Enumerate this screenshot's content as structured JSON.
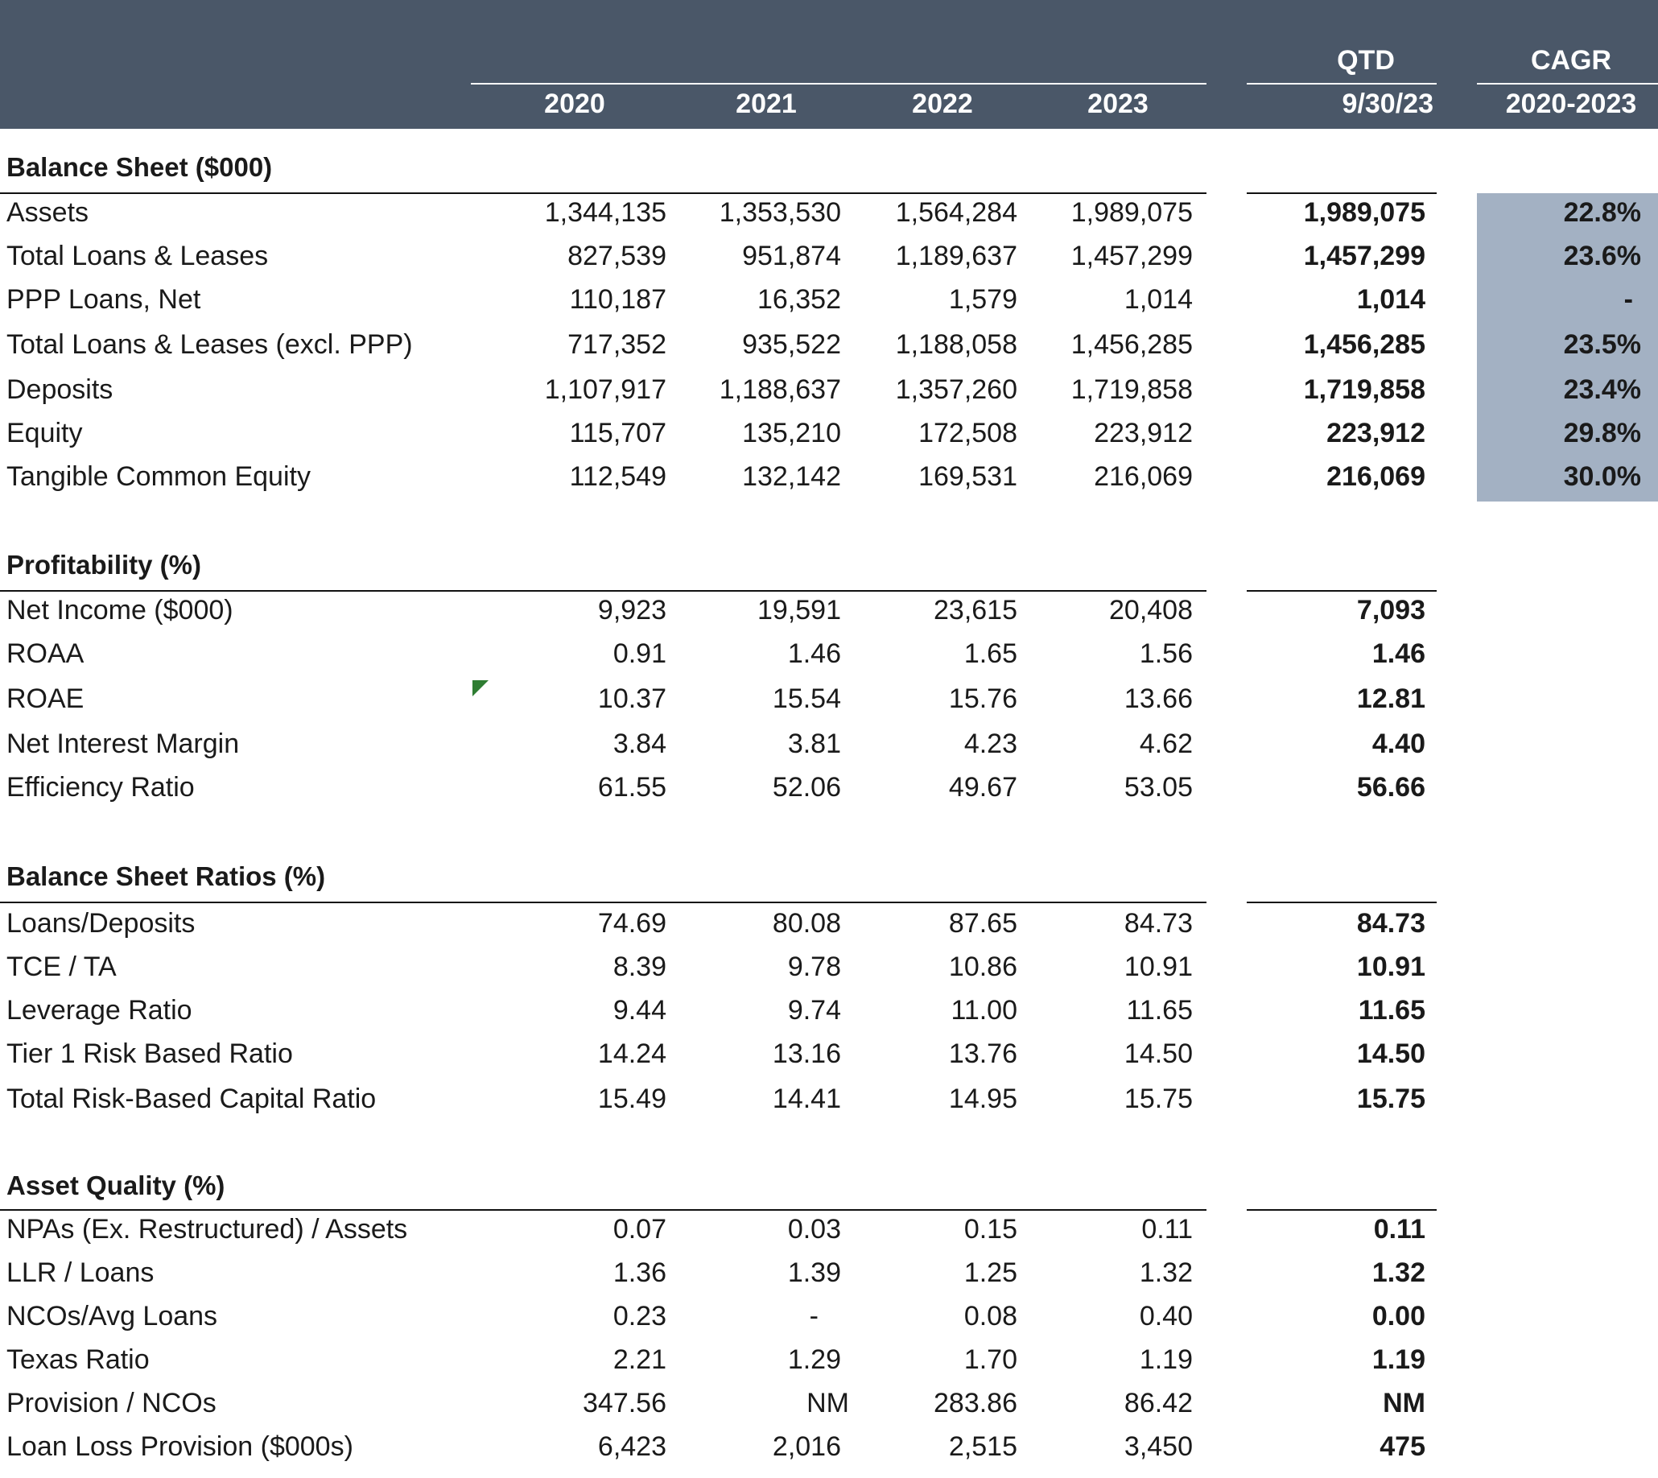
{
  "header": {
    "years": [
      "2020",
      "2021",
      "2022",
      "2023"
    ],
    "qtd_top": "QTD",
    "qtd_bottom": "9/30/23",
    "cagr_top": "CAGR",
    "cagr_bottom": "2020-2023"
  },
  "sections": [
    {
      "title": "Balance Sheet ($000)",
      "rows": [
        {
          "label": "Assets",
          "values": [
            "1,344,135",
            "1,353,530",
            "1,564,284",
            "1,989,075"
          ],
          "qtd": "1,989,075",
          "cagr": "22.8%"
        },
        {
          "label": "Total Loans & Leases",
          "values": [
            "827,539",
            "951,874",
            "1,189,637",
            "1,457,299"
          ],
          "qtd": "1,457,299",
          "cagr": "23.6%"
        },
        {
          "label": "PPP Loans, Net",
          "values": [
            "110,187",
            "16,352",
            "1,579",
            "1,014"
          ],
          "qtd": "1,014",
          "cagr": "-"
        },
        {
          "label": "Total Loans & Leases (excl. PPP)",
          "values": [
            "717,352",
            "935,522",
            "1,188,058",
            "1,456,285"
          ],
          "qtd": "1,456,285",
          "cagr": "23.5%"
        },
        {
          "label": "Deposits",
          "values": [
            "1,107,917",
            "1,188,637",
            "1,357,260",
            "1,719,858"
          ],
          "qtd": "1,719,858",
          "cagr": "23.4%"
        },
        {
          "label": "Equity",
          "values": [
            "115,707",
            "135,210",
            "172,508",
            "223,912"
          ],
          "qtd": "223,912",
          "cagr": "29.8%"
        },
        {
          "label": "Tangible Common Equity",
          "values": [
            "112,549",
            "132,142",
            "169,531",
            "216,069"
          ],
          "qtd": "216,069",
          "cagr": "30.0%"
        }
      ]
    },
    {
      "title": "Profitability (%)",
      "rows": [
        {
          "label": "Net Income ($000)",
          "values": [
            "9,923",
            "19,591",
            "23,615",
            "20,408"
          ],
          "qtd": "7,093"
        },
        {
          "label": "ROAA",
          "values": [
            "0.91",
            "1.46",
            "1.65",
            "1.56"
          ],
          "qtd": "1.46"
        },
        {
          "label": "ROAE",
          "values": [
            "10.37",
            "15.54",
            "15.76",
            "13.66"
          ],
          "qtd": "12.81"
        },
        {
          "label": "Net Interest Margin",
          "values": [
            "3.84",
            "3.81",
            "4.23",
            "4.62"
          ],
          "qtd": "4.40"
        },
        {
          "label": "Efficiency Ratio",
          "values": [
            "61.55",
            "52.06",
            "49.67",
            "53.05"
          ],
          "qtd": "56.66"
        }
      ]
    },
    {
      "title": "Balance Sheet Ratios (%)",
      "rows": [
        {
          "label": "Loans/Deposits",
          "values": [
            "74.69",
            "80.08",
            "87.65",
            "84.73"
          ],
          "qtd": "84.73"
        },
        {
          "label": "TCE / TA",
          "values": [
            "8.39",
            "9.78",
            "10.86",
            "10.91"
          ],
          "qtd": "10.91"
        },
        {
          "label": "Leverage Ratio",
          "values": [
            "9.44",
            "9.74",
            "11.00",
            "11.65"
          ],
          "qtd": "11.65"
        },
        {
          "label": "Tier 1 Risk Based Ratio",
          "values": [
            "14.24",
            "13.16",
            "13.76",
            "14.50"
          ],
          "qtd": "14.50"
        },
        {
          "label": "Total Risk-Based Capital Ratio",
          "values": [
            "15.49",
            "14.41",
            "14.95",
            "15.75"
          ],
          "qtd": "15.75"
        }
      ]
    },
    {
      "title": "Asset Quality (%)",
      "rows": [
        {
          "label": "NPAs (Ex. Restructured) / Assets",
          "values": [
            "0.07",
            "0.03",
            "0.15",
            "0.11"
          ],
          "qtd": "0.11"
        },
        {
          "label": "LLR / Loans",
          "values": [
            "1.36",
            "1.39",
            "1.25",
            "1.32"
          ],
          "qtd": "1.32"
        },
        {
          "label": "NCOs/Avg Loans",
          "values": [
            "0.23",
            "-",
            "0.08",
            "0.40"
          ],
          "qtd": "0.00"
        },
        {
          "label": "Texas Ratio",
          "values": [
            "2.21",
            "1.29",
            "1.70",
            "1.19"
          ],
          "qtd": "1.19"
        },
        {
          "label": "Provision / NCOs",
          "values": [
            "347.56",
            "NM",
            "283.86",
            "86.42"
          ],
          "qtd": "NM"
        },
        {
          "label": "Loan Loss Provision ($000s)",
          "values": [
            "6,423",
            "2,016",
            "2,515",
            "3,450"
          ],
          "qtd": "475"
        }
      ]
    }
  ]
}
